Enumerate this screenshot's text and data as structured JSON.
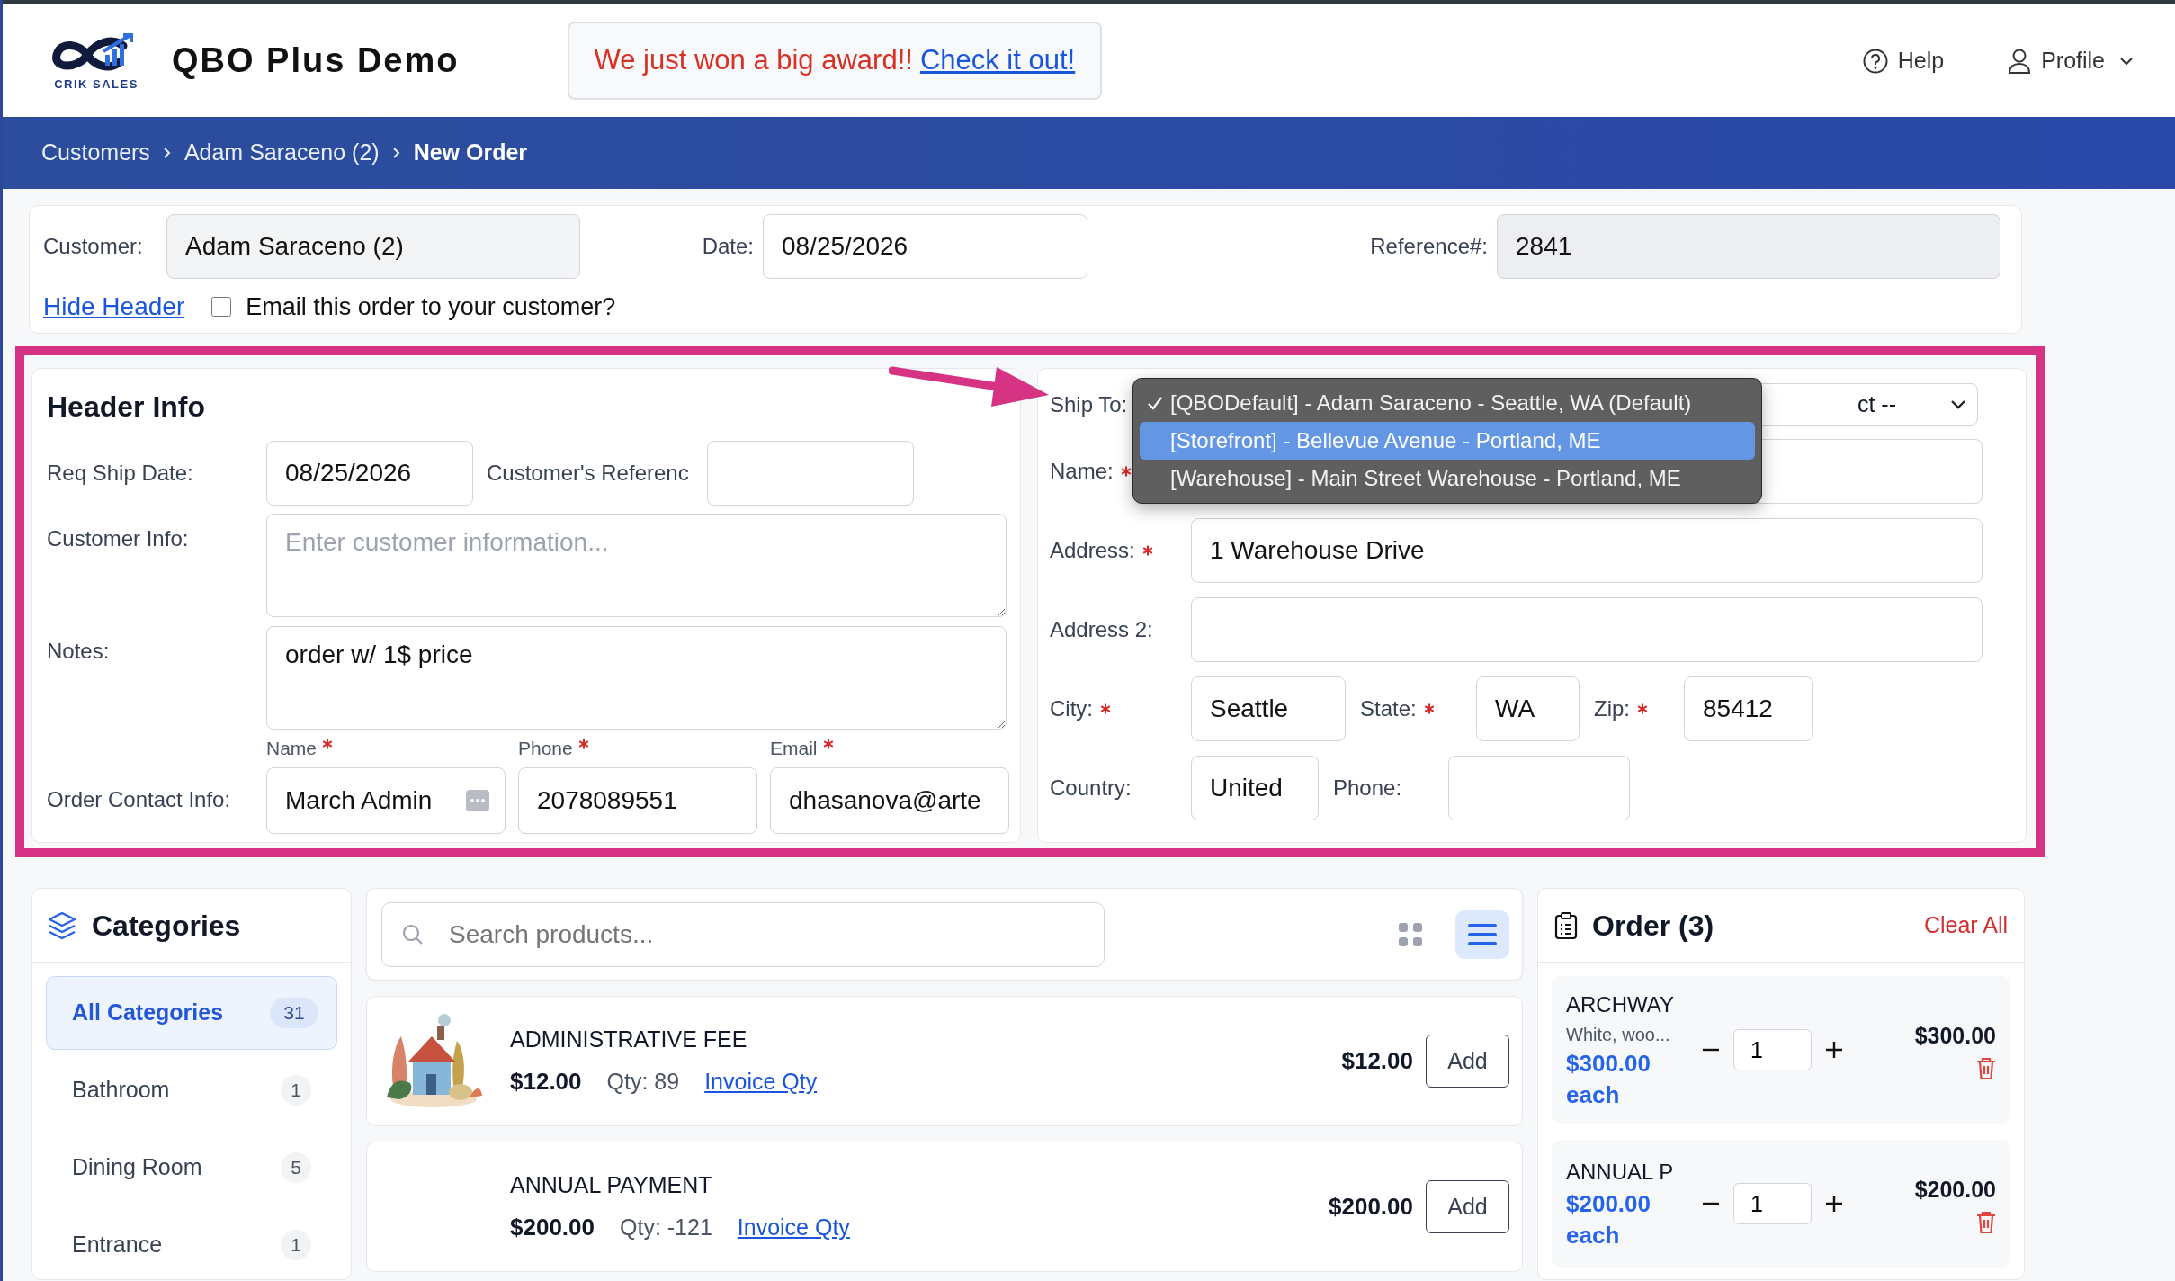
{
  "header": {
    "logo_text": "CRIK SALES",
    "brand": "QBO Plus Demo",
    "announcement": {
      "text": "We just won a big award!!",
      "link": "Check it out!"
    },
    "nav": [
      {
        "kind": "help",
        "label": "Help"
      },
      {
        "kind": "profile",
        "label": "Profile"
      }
    ]
  },
  "breadcrumb": [
    {
      "label": "Customers",
      "selected": false
    },
    {
      "label": "Adam Saraceno (2)",
      "selected": false
    },
    {
      "label": "New Order",
      "selected": true
    }
  ],
  "order_header": {
    "customer": {
      "label": "Customer:",
      "value": "Adam Saraceno (2)"
    },
    "date": {
      "label": "Date:",
      "value": "08/25/2026"
    },
    "reference": {
      "label": "Reference#:",
      "value": "2841"
    },
    "hide_header": "Hide Header",
    "email_option": {
      "label": "Email this order to your customer?",
      "checked": false
    }
  },
  "header_info": {
    "title": "Header Info",
    "req_ship_date": {
      "label": "Req Ship Date:",
      "value": "08/25/2026"
    },
    "customer_reference": {
      "label": "Customer's Referenc"
    },
    "customer_info": {
      "label": "Customer Info:",
      "placeholder": "Enter customer information..."
    },
    "notes": {
      "label": "Notes:",
      "value": "order w/ 1$ price"
    },
    "contact": {
      "label": "Order Contact Info:",
      "fields": [
        {
          "label": "Name",
          "required": true,
          "value": "March Admin",
          "autofill": true
        },
        {
          "label": "Phone",
          "required": true,
          "value": "2078089551",
          "autofill": false
        },
        {
          "label": "Email",
          "required": true,
          "value": "dhasanova@arte",
          "autofill": false
        }
      ]
    }
  },
  "ship_to": {
    "label": "Ship To:",
    "select_value": "ct --",
    "options": [
      {
        "label": "[QBODefault] - Adam Saraceno - Seattle, WA (Default)",
        "selected": true,
        "highlighted": false
      },
      {
        "label": "[Storefront] - Bellevue Avenue - Portland, ME",
        "selected": false,
        "highlighted": true
      },
      {
        "label": "[Warehouse] - Main Street Warehouse - Portland, ME",
        "selected": false,
        "highlighted": false
      }
    ],
    "rows": [
      [
        {
          "label": "Name:",
          "required": true
        }
      ],
      [
        {
          "label": "Address:",
          "required": true,
          "value": "1 Warehouse Drive"
        }
      ],
      [
        {
          "label": "Address 2:",
          "required": false
        }
      ],
      [
        {
          "label": "City:",
          "required": true,
          "value": "Seattle"
        },
        {
          "label": "State:",
          "required": true,
          "value": "WA"
        },
        {
          "label": "Zip:",
          "required": true,
          "value": "85412"
        }
      ],
      [
        {
          "label": "Country:",
          "required": false,
          "value": "United"
        },
        {
          "label": "Phone:",
          "required": false
        }
      ]
    ]
  },
  "categories": {
    "title": "Categories",
    "items": [
      {
        "label": "All Categories",
        "count": "31",
        "selected": true
      },
      {
        "label": "Bathroom",
        "count": "1",
        "selected": false
      },
      {
        "label": "Dining Room",
        "count": "5",
        "selected": false
      },
      {
        "label": "Entrance",
        "count": "1",
        "selected": false
      }
    ]
  },
  "products": {
    "search_placeholder": "Search products...",
    "views": [
      {
        "kind": "grid",
        "selected": false
      },
      {
        "kind": "list",
        "selected": true
      }
    ],
    "items": [
      {
        "kind": "picture",
        "name": "ADMINISTRATIVE FEE",
        "price": "$12.00",
        "qty": "Qty: 89",
        "link": "Invoice Qty",
        "list_price": "$12.00",
        "button": "Add"
      },
      {
        "kind": "blank",
        "name": "ANNUAL PAYMENT",
        "price": "$200.00",
        "qty": "Qty: -121",
        "link": "Invoice Qty",
        "list_price": "$200.00",
        "button": "Add"
      }
    ]
  },
  "order": {
    "title": "Order (3)",
    "clear": "Clear All",
    "items": [
      {
        "name": "ARCHWAY",
        "description": "White, woo...",
        "unit_price": "$300.00 each",
        "quantity": "1",
        "total": "$300.00"
      },
      {
        "name": "ANNUAL P",
        "unit_price": "$200.00 each",
        "quantity": "1",
        "total": "$200.00"
      }
    ]
  }
}
